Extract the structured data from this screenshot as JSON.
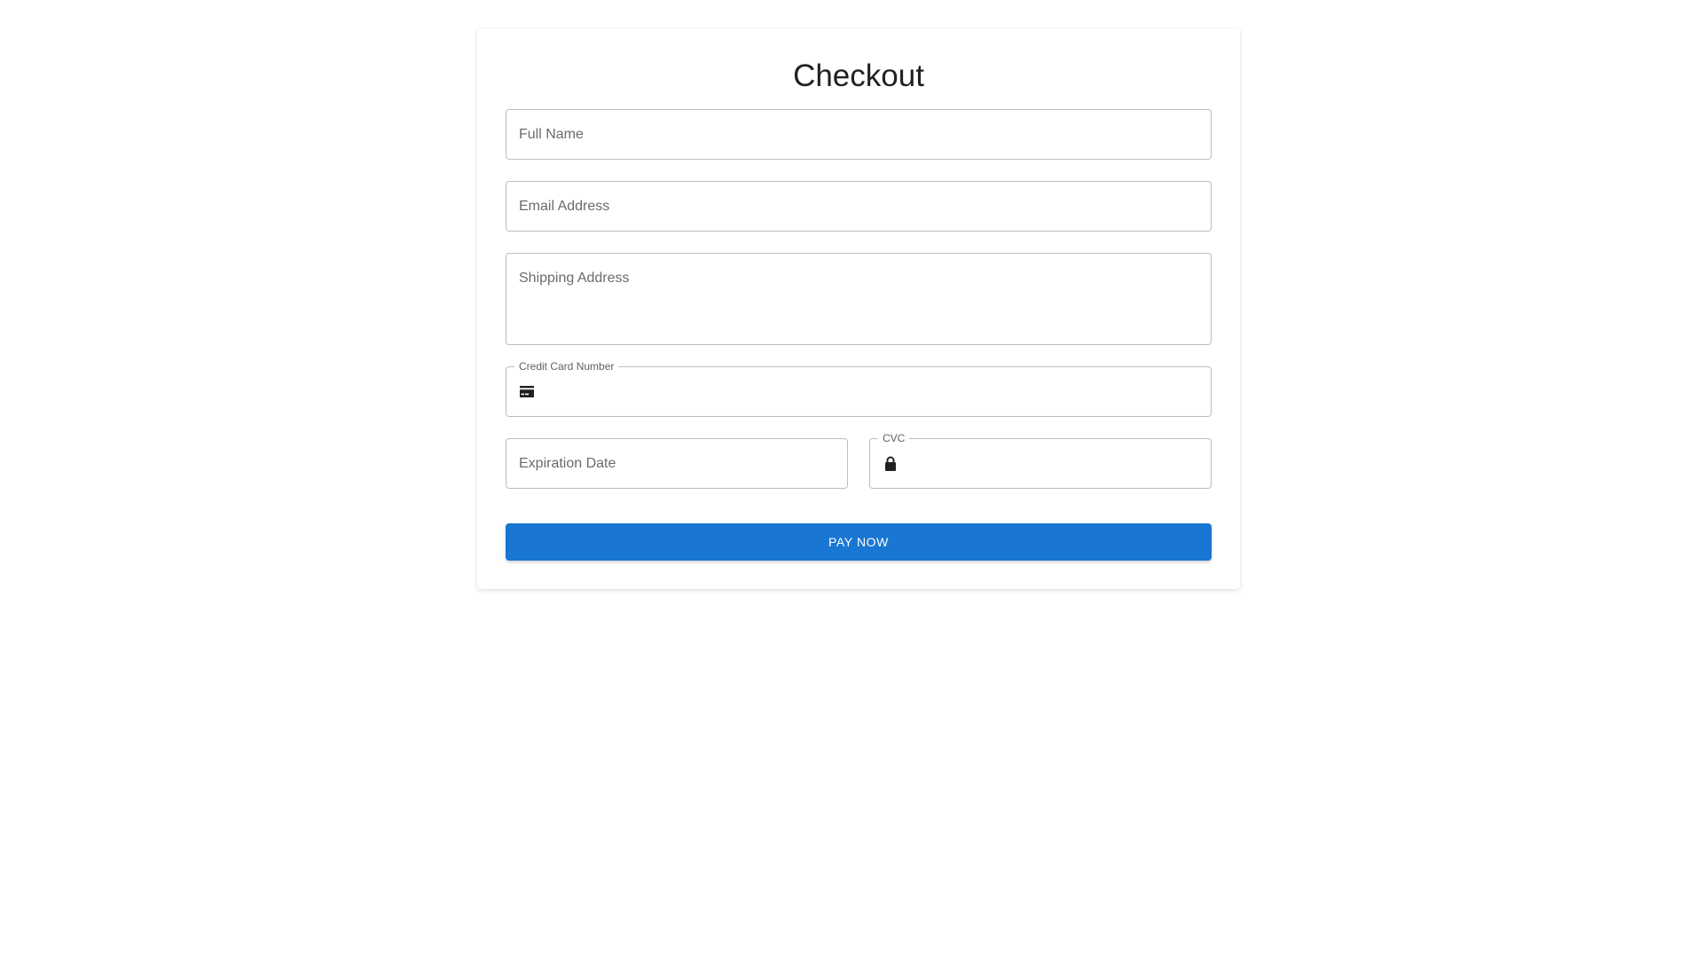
{
  "checkout": {
    "title": "Checkout",
    "full_name": {
      "placeholder": "Full Name",
      "value": ""
    },
    "email": {
      "placeholder": "Email Address",
      "value": ""
    },
    "shipping": {
      "placeholder": "Shipping Address",
      "value": ""
    },
    "card_number": {
      "label": "Credit Card Number",
      "value": "",
      "icon": "credit-card-icon"
    },
    "expiration": {
      "placeholder": "Expiration Date",
      "value": ""
    },
    "cvc": {
      "label": "CVC",
      "value": "",
      "icon": "lock-icon"
    },
    "pay_button": "PAY NOW"
  },
  "colors": {
    "primary": "#1976d2",
    "border": "#bdbdbd",
    "placeholder_text": "#6b6b6b",
    "title_text": "#212121"
  }
}
